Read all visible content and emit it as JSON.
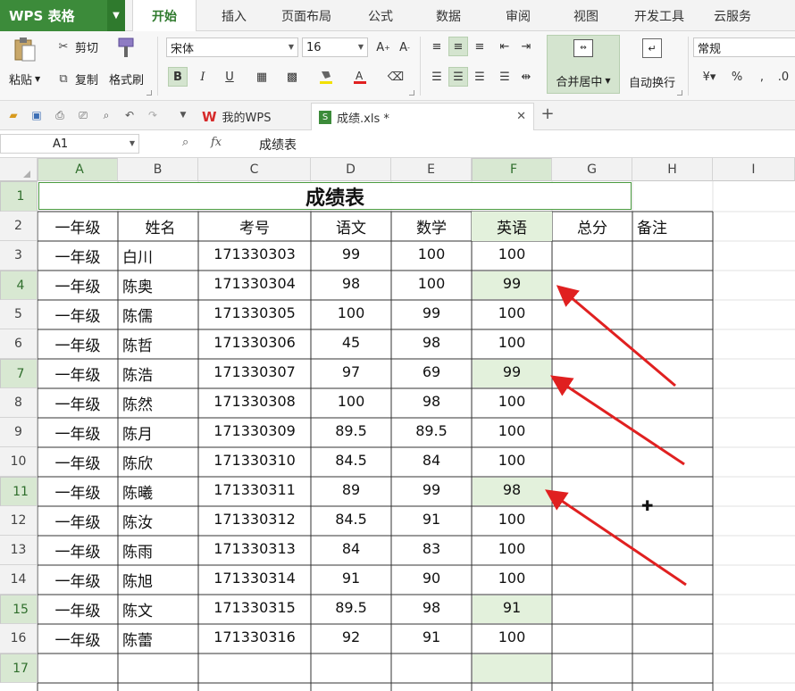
{
  "app": {
    "name": "WPS 表格"
  },
  "ribbon_tabs": [
    "开始",
    "插入",
    "页面布局",
    "公式",
    "数据",
    "审阅",
    "视图",
    "开发工具",
    "云服务"
  ],
  "active_tab": "开始",
  "ribbon": {
    "paste": "粘贴",
    "cut": "剪切",
    "copy": "复制",
    "format_painter": "格式刷",
    "font_name": "宋体",
    "font_size": "16",
    "merge_center": "合并居中",
    "wrap_text": "自动换行",
    "number_format": "常规",
    "percent": "%"
  },
  "doc_tabs": {
    "home": "我的WPS",
    "file": "成绩.xls *"
  },
  "formula_bar": {
    "name_box": "A1",
    "fx": "fx",
    "content": "成绩表"
  },
  "columns": [
    "A",
    "B",
    "C",
    "D",
    "E",
    "F",
    "G",
    "H",
    "I"
  ],
  "rows": [
    "1",
    "2",
    "3",
    "4",
    "5",
    "6",
    "7",
    "8",
    "9",
    "10",
    "11",
    "12",
    "13",
    "14",
    "15",
    "16",
    "17"
  ],
  "sheet": {
    "title": "成绩表",
    "headers": [
      "一年级",
      "姓名",
      "考号",
      "语文",
      "数学",
      "英语",
      "总分",
      "备注"
    ],
    "data": [
      [
        "一年级",
        "白川",
        "171330303",
        "99",
        "100",
        "100"
      ],
      [
        "一年级",
        "陈奥",
        "171330304",
        "98",
        "100",
        "99"
      ],
      [
        "一年级",
        "陈儒",
        "171330305",
        "100",
        "99",
        "100"
      ],
      [
        "一年级",
        "陈哲",
        "171330306",
        "45",
        "98",
        "100"
      ],
      [
        "一年级",
        "陈浩",
        "171330307",
        "97",
        "69",
        "99"
      ],
      [
        "一年级",
        "陈然",
        "171330308",
        "100",
        "98",
        "100"
      ],
      [
        "一年级",
        "陈月",
        "171330309",
        "89.5",
        "89.5",
        "100"
      ],
      [
        "一年级",
        "陈欣",
        "171330310",
        "84.5",
        "84",
        "100"
      ],
      [
        "一年级",
        "陈曦",
        "171330311",
        "89",
        "99",
        "98"
      ],
      [
        "一年级",
        "陈汝",
        "171330312",
        "84.5",
        "91",
        "100"
      ],
      [
        "一年级",
        "陈雨",
        "171330313",
        "84",
        "83",
        "100"
      ],
      [
        "一年级",
        "陈旭",
        "171330314",
        "91",
        "90",
        "100"
      ],
      [
        "一年级",
        "陈文",
        "171330315",
        "89.5",
        "98",
        "91"
      ],
      [
        "一年级",
        "陈蕾",
        "171330316",
        "92",
        "91",
        "100"
      ]
    ]
  },
  "colors": {
    "brand": "#3c8b3a",
    "highlight": "#e3f1dc",
    "arrow": "#e02020",
    "selected_header": "#d8e8d2"
  }
}
